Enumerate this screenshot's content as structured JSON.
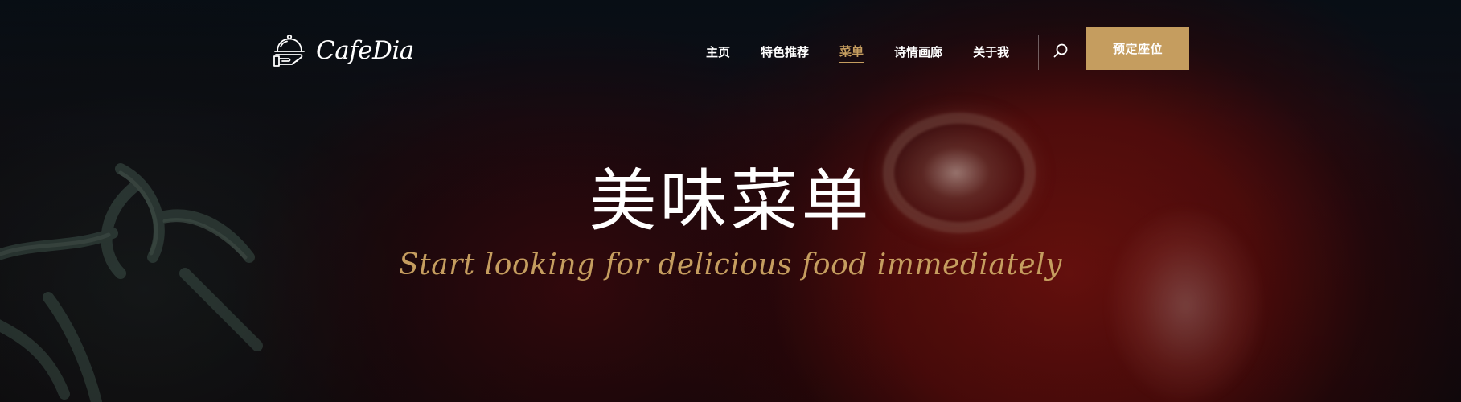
{
  "brand": {
    "name": "CafeDia",
    "icon": "cloche-tray-icon"
  },
  "nav": {
    "items": [
      {
        "label": "主页",
        "active": false
      },
      {
        "label": "特色推荐",
        "active": false
      },
      {
        "label": "菜单",
        "active": true
      },
      {
        "label": "诗情画廊",
        "active": false
      },
      {
        "label": "关于我",
        "active": false
      }
    ],
    "search_icon": "search-icon",
    "reserve_label": "预定座位"
  },
  "hero": {
    "title": "美味菜单",
    "subtitle": "Start looking for delicious food immediately"
  },
  "colors": {
    "accent": "#c59d5f",
    "text": "#ffffff",
    "background": "#0b0b10"
  }
}
